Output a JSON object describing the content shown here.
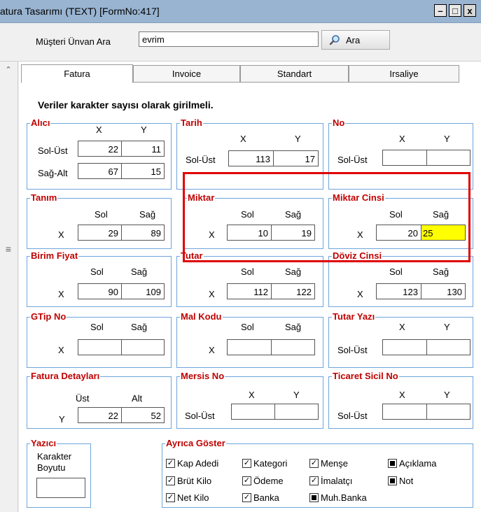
{
  "window": {
    "title": "atura Tasarımı (TEXT) [FormNo:417]",
    "minimize": "–",
    "maximize": "□",
    "close": "x"
  },
  "search": {
    "label": "Müşteri Ünvan Ara",
    "value": "evrim",
    "button": "Ara"
  },
  "tabs": [
    "Fatura",
    "Invoice",
    "Standart",
    "Irsaliye"
  ],
  "heading": "Veriler karakter sayısı olarak girilmeli.",
  "groups": {
    "alici": {
      "title": "Alıcı",
      "col1": "X",
      "col2": "Y",
      "row1": "Sol-Üst",
      "row2": "Sağ-Alt",
      "sol_ust_x": "22",
      "sol_ust_y": "11",
      "sag_alt_x": "67",
      "sag_alt_y": "15"
    },
    "tarih": {
      "title": "Tarih",
      "col1": "X",
      "col2": "Y",
      "row1": "Sol-Üst",
      "x": "113",
      "y": "17"
    },
    "no": {
      "title": "No",
      "col1": "X",
      "col2": "Y",
      "row1": "Sol-Üst",
      "x": "",
      "y": ""
    },
    "tanim": {
      "title": "Tanım",
      "col1": "Sol",
      "col2": "Sağ",
      "row": "X",
      "sol": "29",
      "sag": "89"
    },
    "miktar": {
      "title": "Miktar",
      "col1": "Sol",
      "col2": "Sağ",
      "row": "X",
      "sol": "10",
      "sag": "19"
    },
    "miktar_cinsi": {
      "title": "Miktar Cinsi",
      "col1": "Sol",
      "col2": "Sağ",
      "row": "X",
      "sol": "20",
      "sag": "25"
    },
    "birim_fiyat": {
      "title": "Birim Fiyat",
      "col1": "Sol",
      "col2": "Sağ",
      "row": "X",
      "sol": "90",
      "sag": "109"
    },
    "tutar": {
      "title": "Tutar",
      "col1": "Sol",
      "col2": "Sağ",
      "row": "X",
      "sol": "112",
      "sag": "122"
    },
    "doviz_cinsi": {
      "title": "Döviz Cinsi",
      "col1": "Sol",
      "col2": "Sağ",
      "row": "X",
      "sol": "123",
      "sag": "130"
    },
    "gtip_no": {
      "title": "GTip No",
      "col1": "Sol",
      "col2": "Sağ",
      "row": "X",
      "sol": "",
      "sag": ""
    },
    "mal_kodu": {
      "title": "Mal Kodu",
      "col1": "Sol",
      "col2": "Sağ",
      "row": "X",
      "sol": "",
      "sag": ""
    },
    "tutar_yazi": {
      "title": "Tutar Yazı",
      "col1": "X",
      "col2": "Y",
      "row1": "Sol-Üst",
      "x": "",
      "y": ""
    },
    "fatura_detaylari": {
      "title": "Fatura Detayları",
      "col1": "Üst",
      "col2": "Alt",
      "row": "Y",
      "ust": "22",
      "alt": "52"
    },
    "mersis_no": {
      "title": "Mersis No",
      "col1": "X",
      "col2": "Y",
      "row1": "Sol-Üst",
      "x": "",
      "y": ""
    },
    "ticaret_sicil_no": {
      "title": "Ticaret Sicil No",
      "col1": "X",
      "col2": "Y",
      "row1": "Sol-Üst",
      "x": "",
      "y": ""
    },
    "yazici": {
      "title": "Yazıcı",
      "label": "Karakter\nBoyutu",
      "value": ""
    },
    "ayrica_goster": {
      "title": "Ayrıca Göster",
      "items": [
        {
          "label": "Kap Adedi",
          "state": "checked"
        },
        {
          "label": "Kategori",
          "state": "checked"
        },
        {
          "label": "Menşe",
          "state": "checked"
        },
        {
          "label": "Açıklama",
          "state": "indeterminate"
        },
        {
          "label": "Brüt Kilo",
          "state": "checked"
        },
        {
          "label": "Ödeme",
          "state": "checked"
        },
        {
          "label": "İmalatçı",
          "state": "checked"
        },
        {
          "label": "Not",
          "state": "indeterminate"
        },
        {
          "label": "Net Kilo",
          "state": "checked"
        },
        {
          "label": "Banka",
          "state": "checked"
        },
        {
          "label": "Muh.Banka",
          "state": "indeterminate"
        }
      ]
    }
  }
}
